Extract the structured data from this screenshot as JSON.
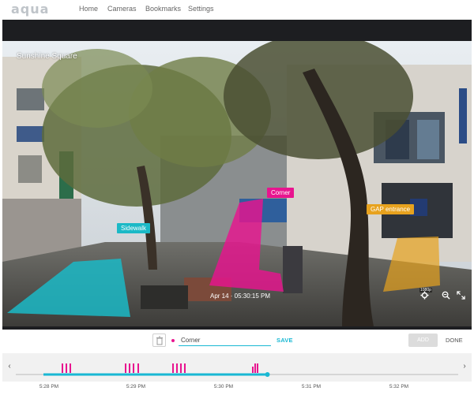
{
  "app": {
    "logo": "aqua"
  },
  "nav": {
    "items": [
      {
        "label": "Home"
      },
      {
        "label": "Cameras"
      },
      {
        "label": "Bookmarks"
      },
      {
        "label": "Settings"
      }
    ]
  },
  "camera": {
    "title": "Sunshine Square",
    "timestamp": "Apr 14 · 05:30:15 PM",
    "resolution_badge": "1080p"
  },
  "zones": [
    {
      "label": "Sidewalk",
      "color": "#1bb9c6"
    },
    {
      "label": "Corner",
      "color": "#e8148f"
    },
    {
      "label": "GAP entrance",
      "color": "#e7a21e"
    }
  ],
  "editor": {
    "zone_name_value": "Corner",
    "zone_color": "#e8148f",
    "save_label": "SAVE",
    "add_label": "ADD",
    "done_label": "DONE"
  },
  "timeline": {
    "tick_labels": [
      "5:28 PM",
      "5:29 PM",
      "5:30 PM",
      "5:31 PM",
      "5:32 PM"
    ],
    "progress_fraction": 0.54,
    "accent": "#19b8d3",
    "event_color": "#e8148f"
  },
  "icons": {
    "trash": "trash-icon",
    "settings": "gear-icon",
    "zoom": "zoom-out-icon",
    "fullscreen": "fullscreen-icon",
    "prev": "chevron-left-icon",
    "next": "chevron-right-icon"
  }
}
